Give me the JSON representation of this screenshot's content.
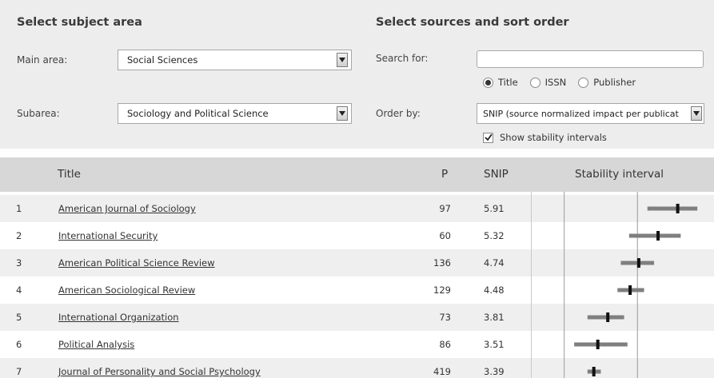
{
  "filters": {
    "subject_heading": "Select subject area",
    "main_area_label": "Main area:",
    "main_area_value": "Social Sciences",
    "subarea_label": "Subarea:",
    "subarea_value": "Sociology and Political Science",
    "sources_heading": "Select sources and sort order",
    "search_label": "Search for:",
    "search_value": "",
    "radio_options": [
      "Title",
      "ISSN",
      "Publisher"
    ],
    "radio_selected": "Title",
    "order_label": "Order by:",
    "order_value": "SNIP (source normalized impact per publicat",
    "stability_checkbox_label": "Show stability intervals",
    "stability_checked": true
  },
  "table": {
    "headers": {
      "title": "Title",
      "p": "P",
      "snip": "SNIP",
      "stability": "Stability interval"
    },
    "rows": [
      {
        "rank": "1",
        "title": "American Journal of Sociology",
        "p": "97",
        "snip": "5.91"
      },
      {
        "rank": "2",
        "title": "International Security",
        "p": "60",
        "snip": "5.32"
      },
      {
        "rank": "3",
        "title": "American Political Science Review",
        "p": "136",
        "snip": "4.74"
      },
      {
        "rank": "4",
        "title": "American Sociological Review",
        "p": "129",
        "snip": "4.48"
      },
      {
        "rank": "5",
        "title": "International Organization",
        "p": "73",
        "snip": "3.81"
      },
      {
        "rank": "6",
        "title": "Political Analysis",
        "p": "86",
        "snip": "3.51"
      },
      {
        "rank": "7",
        "title": "Journal of Personality and Social Psychology",
        "p": "419",
        "snip": "3.39"
      }
    ]
  },
  "chart_data": {
    "type": "interval",
    "ref_lines": [
      2.5,
      4.7
    ],
    "series": [
      {
        "value": 5.91,
        "low": 5.0,
        "high": 6.5
      },
      {
        "value": 5.32,
        "low": 4.45,
        "high": 6.0
      },
      {
        "value": 4.74,
        "low": 4.2,
        "high": 5.2
      },
      {
        "value": 4.48,
        "low": 4.1,
        "high": 4.9
      },
      {
        "value": 3.81,
        "low": 3.2,
        "high": 4.3
      },
      {
        "value": 3.51,
        "low": 2.8,
        "high": 4.4
      },
      {
        "value": 3.39,
        "low": 3.2,
        "high": 3.6
      }
    ],
    "colors": {
      "bar": "#7f7f7f",
      "marker": "#111111",
      "line": "#9a9a9a"
    }
  }
}
